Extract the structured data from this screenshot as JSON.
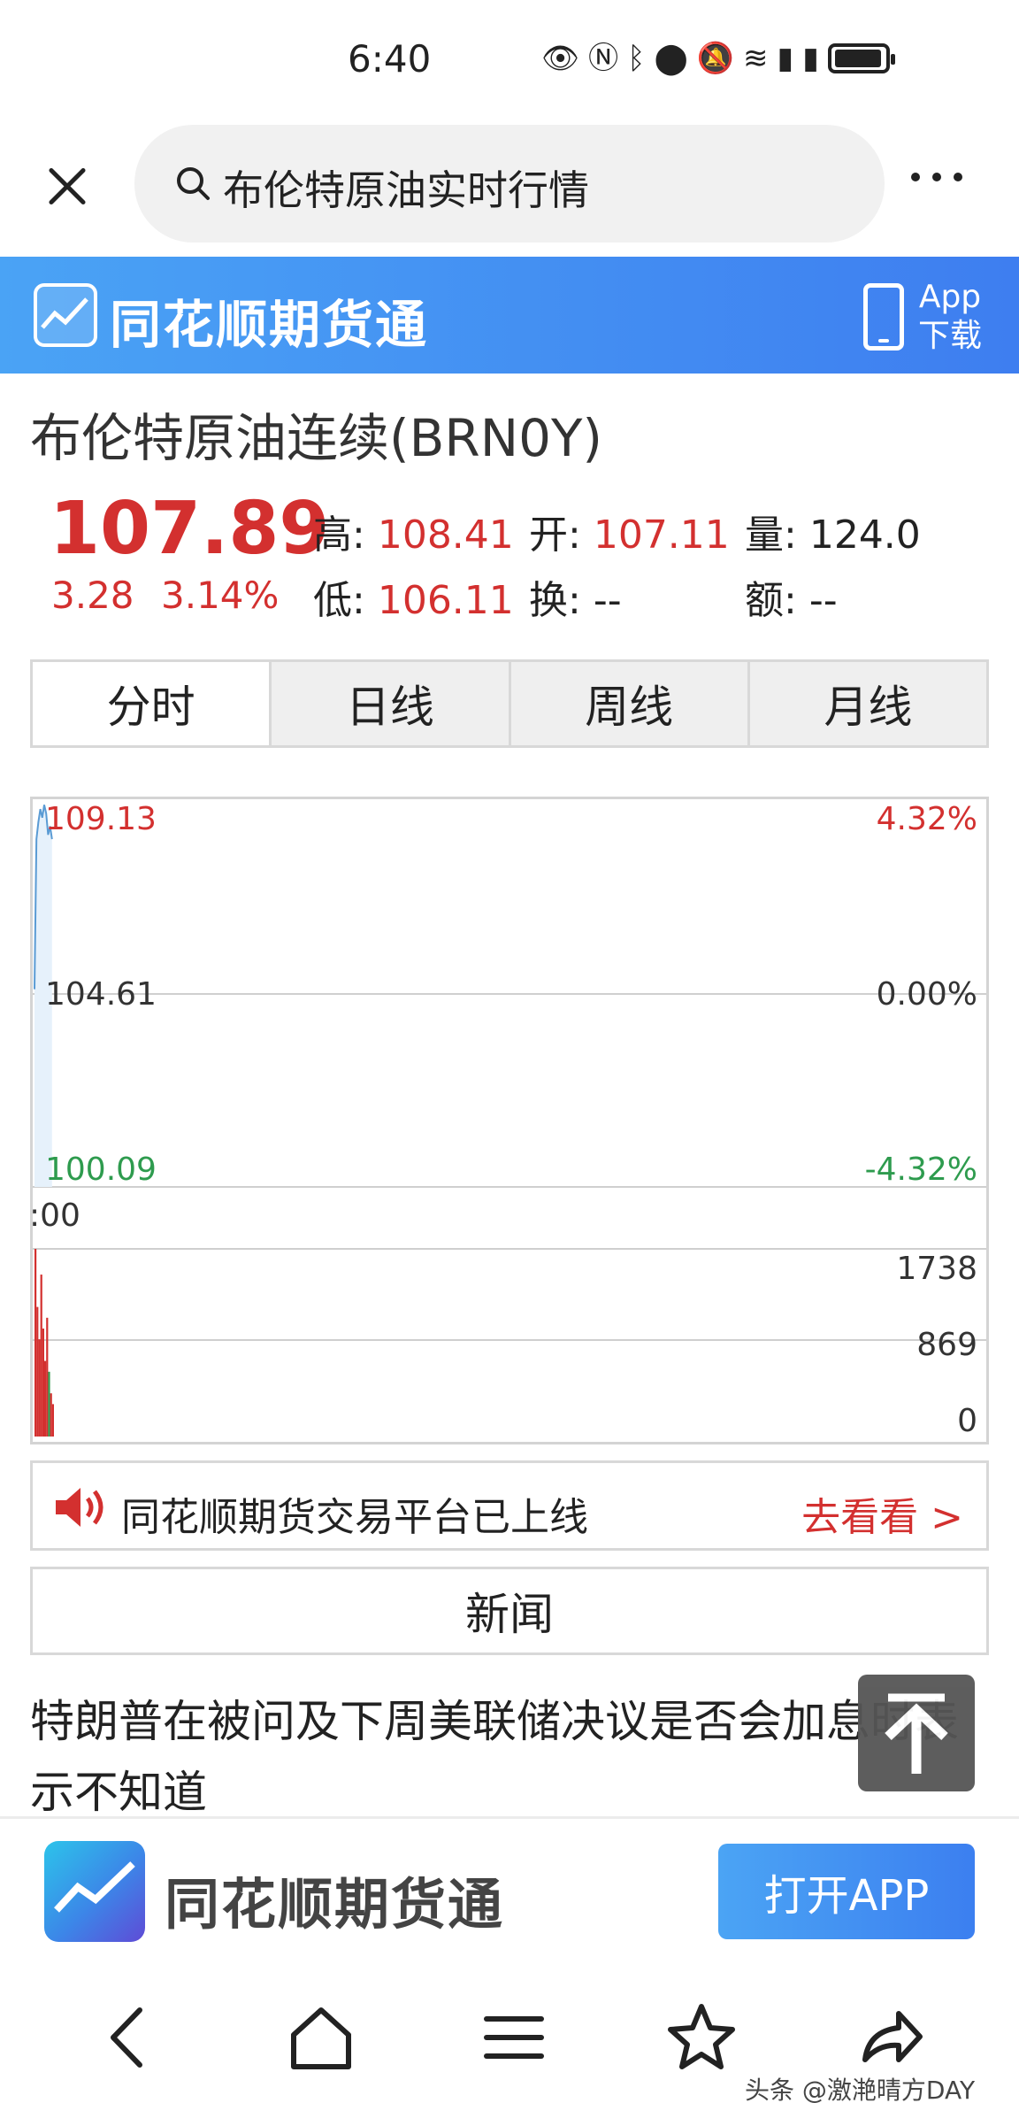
{
  "status": {
    "time": "6:40"
  },
  "search": {
    "query": "布伦特原油实时行情"
  },
  "brand": {
    "name": "同花顺期货通",
    "app_line1": "App",
    "app_line2": "下载"
  },
  "instrument": {
    "title": "布伦特原油连续(BRN0Y)"
  },
  "quote": {
    "price": "107.89",
    "change": "3.28",
    "change_pct": "3.14%",
    "high_label": "高:",
    "high": "108.41",
    "open_label": "开:",
    "open": "107.11",
    "volume_label": "量:",
    "volume": "124.0",
    "low_label": "低:",
    "low": "106.11",
    "turnover_label": "换:",
    "turnover": "--",
    "amount_label": "额:",
    "amount": "--"
  },
  "tabs": [
    "分时",
    "日线",
    "周线",
    "月线"
  ],
  "chart_data": {
    "type": "line",
    "price_axis": {
      "top": "109.13",
      "mid": "104.61",
      "bottom": "100.09"
    },
    "pct_axis": {
      "top": "4.32%",
      "mid": "0.00%",
      "bottom": "-4.32%"
    },
    "time_label": ":00",
    "ylim": [
      100.09,
      109.13
    ],
    "price_series": [
      104.7,
      108.2,
      108.6,
      108.9,
      108.7,
      109.0,
      108.8,
      108.3,
      108.5,
      108.2
    ],
    "volume_axis": {
      "top": "1738",
      "mid": "869",
      "bottom": "0"
    },
    "volume_ylim": [
      0,
      1738
    ],
    "volume_series": [
      1738,
      1200,
      900,
      1500,
      1000,
      700,
      1100,
      600,
      400,
      300
    ]
  },
  "notice": {
    "text": "同花顺期货交易平台已上线",
    "action": "去看看 >"
  },
  "news": {
    "tab_label": "新闻",
    "headline": "特朗普在被问及下周美联储决议是否会加息时表示不知道"
  },
  "footer": {
    "brand": "同花顺期货通",
    "open_app": "打开APP"
  },
  "watermark": "头条 @激滟晴方DAY",
  "colors": {
    "up": "#d3302f",
    "down": "#2e9b4e",
    "accent": "#3e7ef0",
    "line": "#5a9bd4"
  }
}
